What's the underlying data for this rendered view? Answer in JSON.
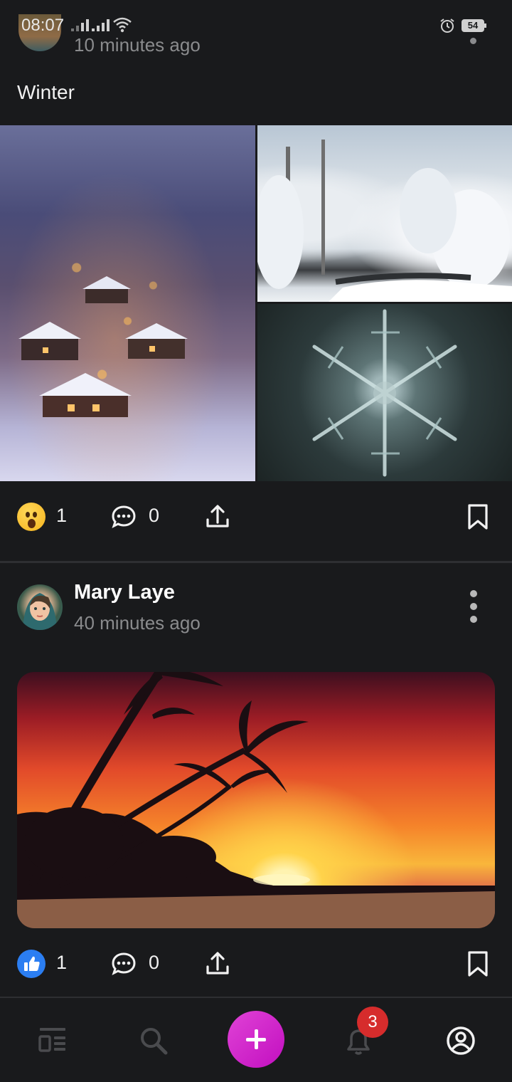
{
  "status_bar": {
    "time": "08:07",
    "battery": "54"
  },
  "post1": {
    "time_ago": "10 minutes ago",
    "text": "Winter",
    "images": [
      "snowy-village-at-dusk",
      "frosted-forest-and-stream",
      "snowflake-macro"
    ],
    "reaction_emoji": "astonished-face",
    "reaction_count": "1",
    "comment_count": "0"
  },
  "post2": {
    "author": "Mary Laye",
    "time_ago": "40 minutes ago",
    "image": "tropical-sunset-palms",
    "reaction_emoji": "thumbs-up",
    "reaction_count": "1",
    "comment_count": "0"
  },
  "bottom_nav": {
    "items": [
      "feed-icon",
      "search-icon",
      "add-icon",
      "bell-icon",
      "profile-icon"
    ],
    "notification_count": "3",
    "fab_color": "#d62bd0"
  },
  "colors": {
    "background": "#191a1c",
    "muted_text": "#8a8b8d",
    "like_blue": "#2b7ef2",
    "badge_red": "#d62c2c"
  }
}
